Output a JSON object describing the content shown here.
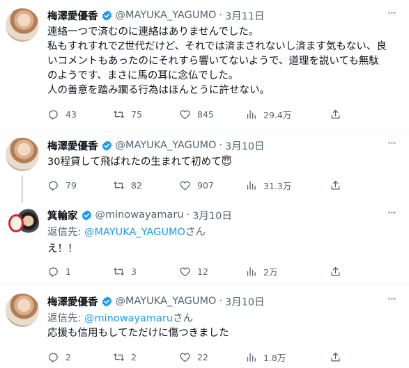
{
  "colors": {
    "accent": "#1d9bf0",
    "secondary_text": "#536471",
    "divider": "#eff3f4",
    "thread_line": "#cfd9de"
  },
  "tweets": [
    {
      "name": "梅澤愛優香",
      "handle": "@MAYUKA_YAGUMO",
      "dot": "·",
      "date": "3月11日",
      "lines": [
        "連絡一つで済むのに連絡はありませんでした。",
        "私もすれすれでZ世代だけど、それでは済まされないし済ます気もない、良",
        "いコメントもあったのにそれすら響いてないようで、道理を説いても無駄",
        "のようです、まさに馬の耳に念仏でした。",
        "人の善意を踏み躙る行為はほんとうに許せない。"
      ],
      "replies": "43",
      "retweets": "75",
      "likes": "845",
      "views": "29.4万"
    },
    {
      "name": "梅澤愛優香",
      "handle": "@MAYUKA_YAGUMO",
      "dot": "·",
      "date": "3月10日",
      "lines": [
        "30程貸して飛ばれたの生まれて初めて😇"
      ],
      "replies": "79",
      "retweets": "82",
      "likes": "907",
      "views": "31.3万"
    },
    {
      "name": "箕輪家",
      "handle": "@minowayamaru",
      "dot": "·",
      "date": "3月10日",
      "reply_prefix": "返信先: ",
      "reply_mention": "@MAYUKA_YAGUMO",
      "reply_suffix": "さん",
      "lines": [
        "え！！"
      ],
      "replies": "1",
      "retweets": "3",
      "likes": "12",
      "views": "2万"
    },
    {
      "name": "梅澤愛優香",
      "handle": "@MAYUKA_YAGUMO",
      "dot": "·",
      "date": "3月10日",
      "reply_prefix": "返信先: ",
      "reply_mention": "@minowayamaru",
      "reply_suffix": "さん",
      "lines": [
        "応援も信用もしてただけに傷つきました"
      ],
      "replies": "2",
      "retweets": "2",
      "likes": "22",
      "views": "1.8万"
    }
  ],
  "icons": {
    "reply": "reply-icon",
    "retweet": "retweet-icon",
    "like": "heart-icon",
    "views": "views-icon",
    "share": "share-icon",
    "verified": "verified-badge-icon",
    "more": "more-icon"
  }
}
